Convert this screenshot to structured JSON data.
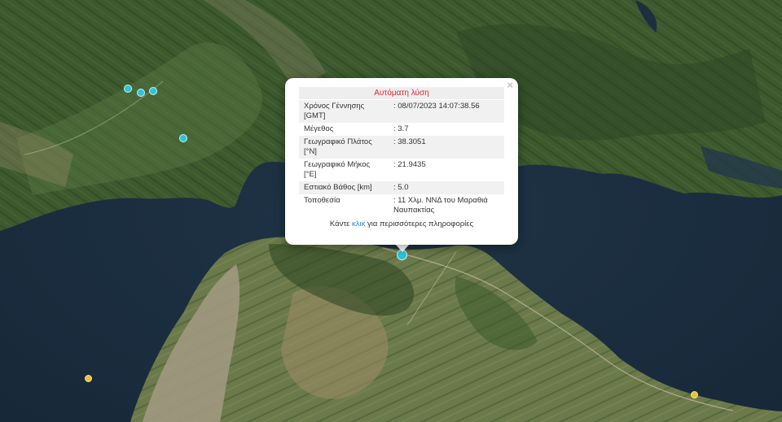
{
  "popup": {
    "title": "Αυτόματη λύση",
    "rows": [
      {
        "label": "Χρόνος Γέννησης [GMT]",
        "value": ": 08/07/2023 14:07:38.56"
      },
      {
        "label": "Μέγεθος",
        "value": ": 3.7"
      },
      {
        "label": "Γεωγραφικό Πλάτος [°N]",
        "value": ": 38.3051"
      },
      {
        "label": "Γεωγραφικό Μήκος [°E]",
        "value": ": 21.9435"
      },
      {
        "label": "Εστιακό Βάθος [km]",
        "value": ": 5.0"
      },
      {
        "label": "Τοποθεσία",
        "value": ": 11 Χλμ. ΝΝΔ του Μαραθιά Ναυπακτίας"
      }
    ],
    "footer_before": "Κάντε ",
    "footer_link": "κλικ",
    "footer_after": " για περισσότερες πληροφορίες",
    "close_symbol": "×"
  },
  "colors": {
    "event_marker": "#2ec4d6",
    "older_event_marker": "#e6c23a",
    "popup_title": "#e0282e",
    "link": "#1e88d2"
  }
}
